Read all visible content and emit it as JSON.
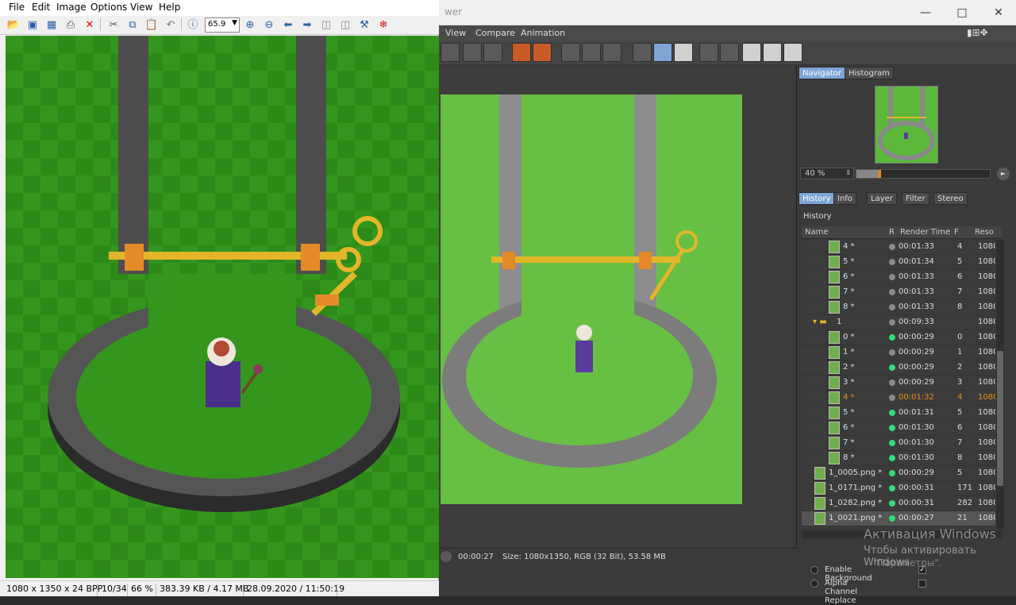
{
  "image_viewer": {
    "menu": [
      "File",
      "Edit",
      "Image",
      "Options",
      "View",
      "Help"
    ],
    "zoom_value": "65.9",
    "status": {
      "dimensions": "1080 x 1350 x 24 BPP",
      "index": "10/34",
      "zoom": "66 %",
      "size": "383.39 KB / 4.17 MB",
      "datetime": "28.09.2020 / 11:50:19"
    },
    "toolbar_icons": [
      "open-icon",
      "thumbnails-icon",
      "save-icon",
      "print-icon",
      "delete-icon",
      "cut-icon",
      "copy-icon",
      "paste-icon",
      "undo-icon",
      "info-icon",
      "zoom-in-icon",
      "zoom-out-icon",
      "previous-icon",
      "next-icon",
      "first-page-icon",
      "last-page-icon",
      "settings-icon",
      "plugin-icon"
    ]
  },
  "picture_viewer": {
    "title": "wer",
    "menu": [
      "View",
      "Compare",
      "Animation"
    ],
    "status": {
      "time": "00:00:27",
      "info": "Size: 1080x1350, RGB (32 Bit), 53.58 MB"
    },
    "nav_tabs": [
      "Navigator",
      "Histogram"
    ],
    "zoom_label": "40 %",
    "zoom_level_percent": 40,
    "panel_tabs": [
      "History",
      "Info",
      "Layer",
      "Filter",
      "Stereo"
    ],
    "history_label": "History",
    "columns": [
      "Name",
      "R",
      "Render Time",
      "F",
      "Reso"
    ],
    "rows": [
      {
        "name": "4 *",
        "time": "00:01:33",
        "frame": "4",
        "res": "1080",
        "status": "grey",
        "level": 2
      },
      {
        "name": "5 *",
        "time": "00:01:34",
        "frame": "5",
        "res": "1080",
        "status": "grey",
        "level": 2
      },
      {
        "name": "6 *",
        "time": "00:01:33",
        "frame": "6",
        "res": "1080",
        "status": "grey",
        "level": 2
      },
      {
        "name": "7 *",
        "time": "00:01:33",
        "frame": "7",
        "res": "1080",
        "status": "grey",
        "level": 2
      },
      {
        "name": "8 *",
        "time": "00:01:33",
        "frame": "8",
        "res": "1080",
        "status": "grey",
        "level": 2
      },
      {
        "name": "1",
        "time": "00:09:33",
        "frame": "",
        "res": "1080",
        "status": "grey",
        "level": 1,
        "folder": true
      },
      {
        "name": "0 *",
        "time": "00:00:29",
        "frame": "0",
        "res": "1080",
        "status": "green",
        "level": 2
      },
      {
        "name": "1 *",
        "time": "00:00:29",
        "frame": "1",
        "res": "1080",
        "status": "grey",
        "level": 2
      },
      {
        "name": "2 *",
        "time": "00:00:29",
        "frame": "2",
        "res": "1080",
        "status": "green",
        "level": 2
      },
      {
        "name": "3 *",
        "time": "00:00:29",
        "frame": "3",
        "res": "1080",
        "status": "grey",
        "level": 2
      },
      {
        "name": "4 *",
        "time": "00:01:32",
        "frame": "4",
        "res": "1080",
        "status": "grey",
        "level": 2,
        "highlight": true
      },
      {
        "name": "5 *",
        "time": "00:01:31",
        "frame": "5",
        "res": "1080",
        "status": "green",
        "level": 2
      },
      {
        "name": "6 *",
        "time": "00:01:30",
        "frame": "6",
        "res": "1080",
        "status": "green",
        "level": 2
      },
      {
        "name": "7 *",
        "time": "00:01:30",
        "frame": "7",
        "res": "1080",
        "status": "green",
        "level": 2
      },
      {
        "name": "8 *",
        "time": "00:01:30",
        "frame": "8",
        "res": "1080",
        "status": "green",
        "level": 2
      },
      {
        "name": "1_0005.png *",
        "time": "00:00:29",
        "frame": "5",
        "res": "1080",
        "status": "green",
        "level": 0
      },
      {
        "name": "1_0171.png *",
        "time": "00:00:31",
        "frame": "171",
        "res": "1080",
        "status": "green",
        "level": 0
      },
      {
        "name": "1_0282.png *",
        "time": "00:00:31",
        "frame": "282",
        "res": "1080",
        "status": "green",
        "level": 0
      },
      {
        "name": "1_0021.png *",
        "time": "00:00:27",
        "frame": "21",
        "res": "1080",
        "status": "green",
        "level": 0,
        "selected": true
      }
    ],
    "options": [
      {
        "label": "Enable Background",
        "checked": true
      },
      {
        "label": "Alpha Channel Replace",
        "checked": false
      }
    ],
    "watermark": [
      "Активация Windows",
      "Чтобы активировать Windows",
      "\"Параметры\"."
    ]
  },
  "colors": {
    "green_dot": "#33dd77",
    "highlight": "#f08a18",
    "grass_dark": "#2e8a18",
    "grass_light": "#5cb83a"
  }
}
